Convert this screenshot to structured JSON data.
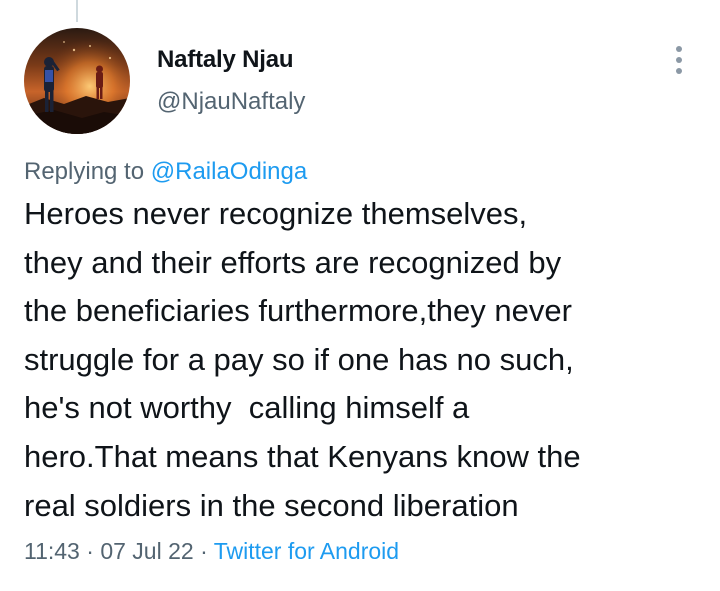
{
  "author": {
    "display_name": "Naftaly Njau",
    "handle": "@NjauNaftaly",
    "avatar_icon": "user-avatar-photo"
  },
  "reply": {
    "prefix": "Replying to",
    "mention": "@RailaOdinga"
  },
  "tweet": {
    "text": "Heroes never recognize themselves,\nthey and their efforts are recognized by\nthe beneficiaries furthermore,they never\nstruggle for a pay so if one has no such,\nhe's not worthy  calling himself a\nhero.That means that Kenyans know the\nreal soldiers in the second liberation"
  },
  "meta": {
    "time": "11:43",
    "separator": "·",
    "date": "07 Jul 22",
    "source": "Twitter for Android"
  },
  "menu": {
    "icon": "more-vertical-icon"
  },
  "colors": {
    "link": "#1d9bf0",
    "secondary_text": "#536471",
    "primary_text": "#0f1419"
  }
}
